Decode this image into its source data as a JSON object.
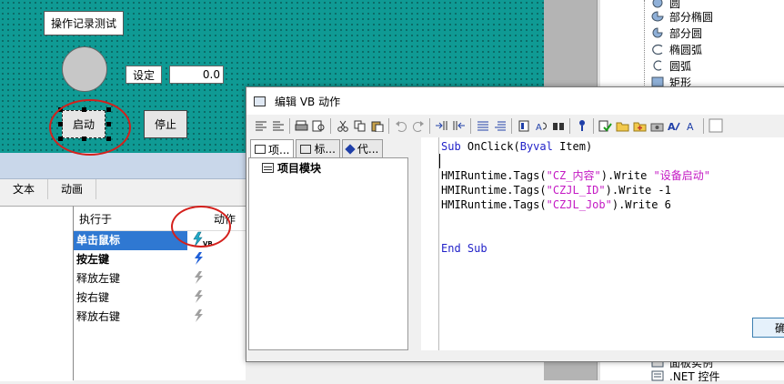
{
  "canvas": {
    "title_label": "操作记录测试",
    "set_label": "设定",
    "set_value": "0.0",
    "start_button": "启动",
    "stop_button": "停止"
  },
  "right_tree": {
    "items": [
      "圆",
      "部分椭圆",
      "部分圆",
      "椭圆弧",
      "圆弧",
      "矩形"
    ],
    "bottom_items": [
      "面板实例",
      ".NET 控件"
    ]
  },
  "props": {
    "tabs": [
      "文本",
      "动画"
    ],
    "col_trigger": "执行于",
    "col_action": "动作",
    "events": [
      {
        "label": "单击鼠标",
        "selected": true,
        "bold": true
      },
      {
        "label": "按左键",
        "selected": false,
        "bold": true
      },
      {
        "label": "释放左键",
        "selected": false,
        "bold": false
      },
      {
        "label": "按右键",
        "selected": false,
        "bold": false
      },
      {
        "label": "释放右键",
        "selected": false,
        "bold": false
      }
    ],
    "vb_badge": "VB"
  },
  "dialog": {
    "title": "编辑 VB 动作",
    "tabs": [
      "项...",
      "标...",
      "代..."
    ],
    "tree_node": "项目模块",
    "ok_label": "确",
    "code": {
      "l1_kw": "Sub",
      "l1_rest": " OnClick(",
      "l1_kw2": "Byval",
      "l1_end": " Item)",
      "l2_pre": "HMIRuntime.Tags(",
      "l2_str": "\"CZ_内容\"",
      "l2_mid": ").Write ",
      "l2_val": "\"设备启动\"",
      "l3_pre": "HMIRuntime.Tags(",
      "l3_str": "\"CZJL_ID\"",
      "l3_mid": ").Write -",
      "l3_val": "1",
      "l4_pre": "HMIRuntime.Tags(",
      "l4_str": "\"CZJL_Job\"",
      "l4_mid": ").Write ",
      "l4_val": "6",
      "l5": "End Sub"
    }
  },
  "colors": {
    "canvas_teal": "#0f9a94",
    "selection_blue": "#2f78d2",
    "annotation_red": "#d4201c",
    "code_keyword": "#1f1fc8",
    "code_string": "#c41ac4"
  }
}
